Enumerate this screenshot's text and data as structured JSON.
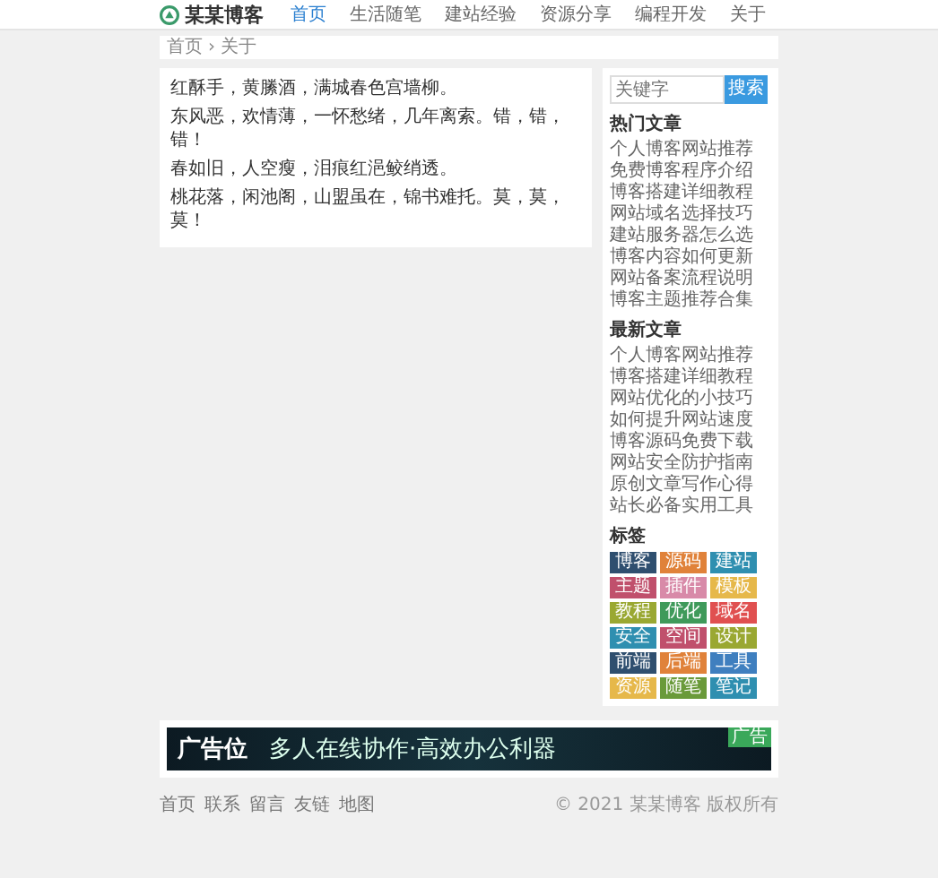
{
  "header": {
    "logo": "某某博客",
    "nav": [
      {
        "label": "首页",
        "selected": true
      },
      {
        "label": "生活随笔",
        "selected": false
      },
      {
        "label": "建站经验",
        "selected": false
      },
      {
        "label": "资源分享",
        "selected": false
      },
      {
        "label": "编程开发",
        "selected": false
      },
      {
        "label": "关于",
        "selected": false
      }
    ]
  },
  "breadcrumb": {
    "separator": "›",
    "items": [
      "首页",
      "关于"
    ]
  },
  "article": {
    "paragraphs": [
      "红酥手，黄縢酒，满城春色宫墙柳。",
      "东风恶，欢情薄，一怀愁绪，几年离索。错，错，错！",
      "春如旧，人空瘦，泪痕红浥鲛绡透。",
      "桃花落，闲池阁，山盟虽在，锦书难托。莫，莫，莫！"
    ]
  },
  "sidebar": {
    "search": {
      "placeholder": "关键字",
      "button": "搜索"
    },
    "sections": [
      {
        "title": "热门文章",
        "items": [
          "个人博客网站推荐",
          "免费博客程序介绍",
          "博客搭建详细教程",
          "网站域名选择技巧",
          "建站服务器怎么选",
          "博客内容如何更新",
          "网站备案流程说明",
          "博客主题推荐合集"
        ]
      },
      {
        "title": "最新文章",
        "items": [
          "个人博客网站推荐",
          "博客搭建详细教程",
          "网站优化的小技巧",
          "如何提升网站速度",
          "博客源码免费下载",
          "网站安全防护指南",
          "原创文章写作心得",
          "站长必备实用工具"
        ]
      }
    ],
    "tags_title": "标签",
    "tags": [
      {
        "label": "博客",
        "color": "#2f4f6f"
      },
      {
        "label": "源码",
        "color": "#e0823a"
      },
      {
        "label": "建站",
        "color": "#2f8fb0"
      },
      {
        "label": "主题",
        "color": "#c0506c"
      },
      {
        "label": "插件",
        "color": "#d88aa8"
      },
      {
        "label": "模板",
        "color": "#e6b84a"
      },
      {
        "label": "教程",
        "color": "#9aa832"
      },
      {
        "label": "优化",
        "color": "#3f9a5a"
      },
      {
        "label": "域名",
        "color": "#e05050"
      },
      {
        "label": "安全",
        "color": "#2f8fb0"
      },
      {
        "label": "空间",
        "color": "#c0506c"
      },
      {
        "label": "设计",
        "color": "#9aa832"
      },
      {
        "label": "前端",
        "color": "#2f4f6f"
      },
      {
        "label": "后端",
        "color": "#e0823a"
      },
      {
        "label": "工具",
        "color": "#3f7fbf"
      },
      {
        "label": "资源",
        "color": "#e6b84a"
      },
      {
        "label": "随笔",
        "color": "#6a9a3a"
      },
      {
        "label": "笔记",
        "color": "#2f8fb0"
      }
    ]
  },
  "ad": {
    "label": "广告位",
    "text": "多人在线协作·高效办公利器",
    "badge": "广告"
  },
  "footer": {
    "links": [
      "首页",
      "联系",
      "留言",
      "友链",
      "地图"
    ],
    "copyright": "© 2021 某某博客 版权所有"
  }
}
